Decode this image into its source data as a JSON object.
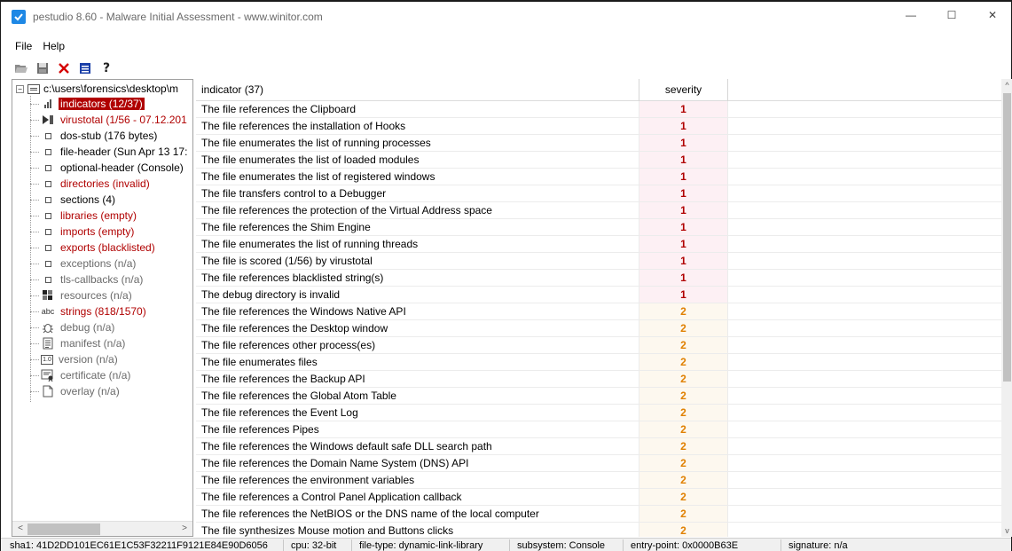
{
  "window": {
    "title": "pestudio 8.60 - Malware Initial Assessment - www.winitor.com",
    "minimize_glyph": "—",
    "maximize_glyph": "☐",
    "close_glyph": "✕"
  },
  "menu": {
    "file": "File",
    "help": "Help"
  },
  "toolbar": {
    "icons": [
      "open-folder-icon",
      "save-icon",
      "delete-icon",
      "list-icon",
      "help-icon"
    ],
    "help_glyph": "?"
  },
  "tree": {
    "root": "c:\\users\\forensics\\desktop\\m",
    "expander": "−",
    "items": [
      {
        "label": "indicators (12/37)",
        "color": "red",
        "selected": true,
        "icon": "bar-chart-icon"
      },
      {
        "label": "virustotal (1/56 - 07.12.201",
        "color": "red",
        "icon": "virustotal-icon"
      },
      {
        "label": "dos-stub (176 bytes)",
        "color": "black",
        "icon": "box-icon"
      },
      {
        "label": "file-header (Sun Apr 13 17:",
        "color": "black",
        "icon": "box-icon"
      },
      {
        "label": "optional-header (Console)",
        "color": "black",
        "icon": "box-icon"
      },
      {
        "label": "directories (invalid)",
        "color": "red",
        "icon": "box-icon"
      },
      {
        "label": "sections (4)",
        "color": "black",
        "icon": "box-icon"
      },
      {
        "label": "libraries (empty)",
        "color": "red",
        "icon": "box-icon"
      },
      {
        "label": "imports (empty)",
        "color": "red",
        "icon": "box-icon"
      },
      {
        "label": "exports (blacklisted)",
        "color": "red",
        "icon": "box-icon"
      },
      {
        "label": "exceptions (n/a)",
        "color": "gray",
        "icon": "box-icon"
      },
      {
        "label": "tls-callbacks (n/a)",
        "color": "gray",
        "icon": "box-icon"
      },
      {
        "label": "resources (n/a)",
        "color": "gray",
        "icon": "resources-icon"
      },
      {
        "label": "strings (818/1570)",
        "color": "red",
        "icon": "abc-icon",
        "icon_text": "abc"
      },
      {
        "label": "debug (n/a)",
        "color": "gray",
        "icon": "bug-icon"
      },
      {
        "label": "manifest (n/a)",
        "color": "gray",
        "icon": "manifest-icon"
      },
      {
        "label": "version (n/a)",
        "color": "gray",
        "icon": "version-icon",
        "icon_text": "1.0"
      },
      {
        "label": "certificate (n/a)",
        "color": "gray",
        "icon": "certificate-icon"
      },
      {
        "label": "overlay (n/a)",
        "color": "gray",
        "icon": "overlay-icon"
      }
    ],
    "scroll_left": "<",
    "scroll_right": ">"
  },
  "table": {
    "headers": {
      "indicator": "indicator (37)",
      "severity": "severity"
    },
    "rows": [
      {
        "indicator": "The file references the Clipboard",
        "severity": "1"
      },
      {
        "indicator": "The file references the installation of Hooks",
        "severity": "1"
      },
      {
        "indicator": "The file enumerates the list of running processes",
        "severity": "1"
      },
      {
        "indicator": "The file enumerates the list of loaded modules",
        "severity": "1"
      },
      {
        "indicator": "The file enumerates the list of registered windows",
        "severity": "1"
      },
      {
        "indicator": "The file transfers control to a Debugger",
        "severity": "1"
      },
      {
        "indicator": "The file references the protection of the Virtual Address space",
        "severity": "1"
      },
      {
        "indicator": "The file references the Shim Engine",
        "severity": "1"
      },
      {
        "indicator": "The file enumerates the list of running threads",
        "severity": "1"
      },
      {
        "indicator": "The file is scored (1/56) by virustotal",
        "severity": "1"
      },
      {
        "indicator": "The file references blacklisted string(s)",
        "severity": "1"
      },
      {
        "indicator": "The debug directory is invalid",
        "severity": "1"
      },
      {
        "indicator": "The file references the Windows Native API",
        "severity": "2"
      },
      {
        "indicator": "The file references the Desktop window",
        "severity": "2"
      },
      {
        "indicator": "The file references other process(es)",
        "severity": "2"
      },
      {
        "indicator": "The file enumerates files",
        "severity": "2"
      },
      {
        "indicator": "The file references the Backup API",
        "severity": "2"
      },
      {
        "indicator": "The file references the Global Atom Table",
        "severity": "2"
      },
      {
        "indicator": "The file references the Event Log",
        "severity": "2"
      },
      {
        "indicator": "The file references Pipes",
        "severity": "2"
      },
      {
        "indicator": "The file references the Windows default safe DLL search path",
        "severity": "2"
      },
      {
        "indicator": "The file references the Domain Name System (DNS) API",
        "severity": "2"
      },
      {
        "indicator": "The file references the environment variables",
        "severity": "2"
      },
      {
        "indicator": "The file references a Control Panel Application callback",
        "severity": "2"
      },
      {
        "indicator": "The file references the NetBIOS or the DNS name of the local computer",
        "severity": "2"
      },
      {
        "indicator": "The file synthesizes Mouse motion and Buttons clicks",
        "severity": "2"
      }
    ],
    "scroll_up": "^",
    "scroll_down": "v"
  },
  "status": {
    "sha1": "sha1: 41D2DD101EC61E1C53F32211F9121E84E90D6056",
    "cpu": "cpu: 32-bit",
    "file_type": "file-type: dynamic-link-library",
    "subsystem": "subsystem: Console",
    "entry_point": "entry-point: 0x0000B63E",
    "signature": "signature: n/a"
  },
  "colors": {
    "selection": "#b00000",
    "severity1": "#b00000",
    "severity2": "#e08000",
    "accent": "#1e88e5"
  }
}
